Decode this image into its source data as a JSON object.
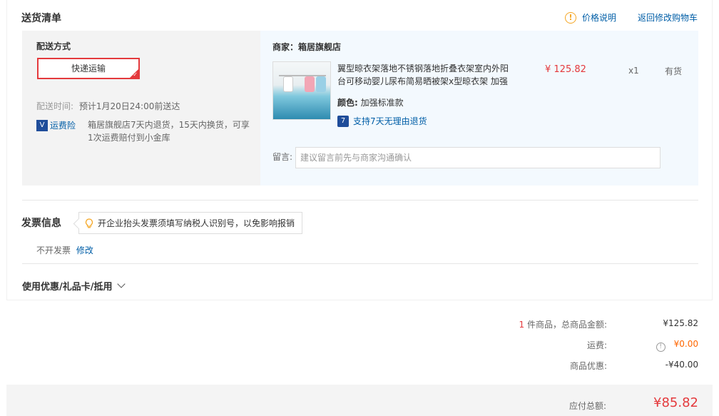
{
  "delivery": {
    "title": "送货清单",
    "price_info_icon": "!",
    "price_info_label": "价格说明",
    "back_to_cart_label": "返回修改购物车",
    "method_label": "配送方式",
    "method_value": "快递运输",
    "time_label": "配送时间:",
    "time_value": "预计1月20日24:00前送达",
    "insurance_icon": "V",
    "insurance_label": "运费险",
    "insurance_desc": "箱居旗舰店7天内退货，15天内换货，可享1次运费赔付到小金库"
  },
  "shop": {
    "merchant_label": "商家：箱居旗舰店",
    "product": {
      "title": "翼型晾衣架落地不锈钢落地折叠衣架室内外阳台可移动婴儿尿布简易晒被架x型晾衣架 加强",
      "color_label": "颜色:",
      "color_value": "加强标准款",
      "return_icon": "7",
      "return_label": "支持7天无理由退货",
      "price": "¥ 125.82",
      "qty": "x1",
      "stock": "有货"
    },
    "message_label": "留言:",
    "message_placeholder": "建议留言前先与商家沟通确认"
  },
  "invoice": {
    "title": "发票信息",
    "tip": "开企业抬头发票须填写纳税人识别号，以免影响报销",
    "status": "不开发票",
    "modify_label": "修改"
  },
  "coupon": {
    "label": "使用优惠/礼品卡/抵用"
  },
  "summary": {
    "item_count": "1",
    "goods_label": " 件商品，总商品金额:",
    "goods_value": "¥125.82",
    "freight_label": "运费:",
    "freight_icon": "!",
    "freight_value": "¥0.00",
    "discount_label": "商品优惠:",
    "discount_value": "-¥40.00",
    "total_label": "应付总额:",
    "total_value": "¥85.82"
  },
  "colors": {
    "accent_red": "#e4393c",
    "link_blue": "#005ea7",
    "orange": "#ff6600",
    "shop_bg": "#f3f9fe"
  }
}
